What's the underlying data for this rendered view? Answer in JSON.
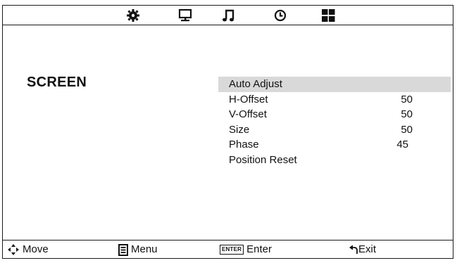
{
  "tabs": [
    {
      "icon": "gear-icon"
    },
    {
      "icon": "monitor-icon"
    },
    {
      "icon": "music-note-icon"
    },
    {
      "icon": "clock-icon"
    },
    {
      "icon": "grid-icon"
    }
  ],
  "page_title": "SCREEN",
  "menu_items": [
    {
      "label": "Auto Adjust",
      "value": "",
      "selected": true
    },
    {
      "label": "H-Offset",
      "value": "50"
    },
    {
      "label": "V-Offset",
      "value": "50"
    },
    {
      "label": "Size",
      "value": "50"
    },
    {
      "label": "Phase",
      "value": "45"
    },
    {
      "label": "Position Reset",
      "value": ""
    }
  ],
  "footer": {
    "move_label": "Move",
    "menu_label": "Menu",
    "enter_badge": "ENTER",
    "enter_label": "Enter",
    "exit_label": "Exit"
  },
  "colors": {
    "selection": "#d9d9d9",
    "line": "#1a1a1a"
  }
}
